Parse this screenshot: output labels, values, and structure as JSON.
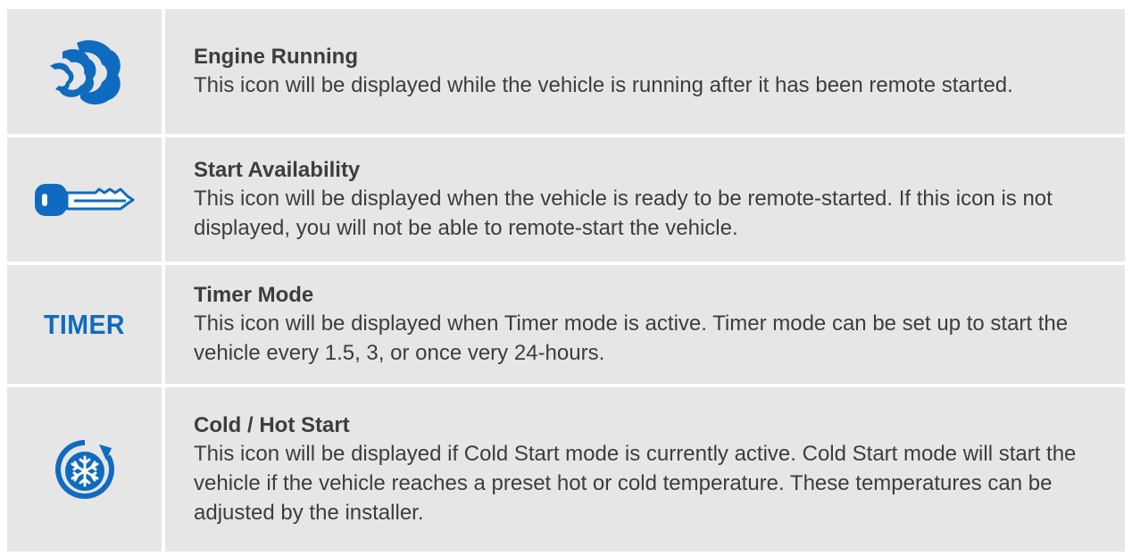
{
  "colors": {
    "row_bg": "#e6e6e6",
    "icon_blue": "#0f6bbf",
    "text": "#3d3d3d"
  },
  "rows": [
    {
      "icon": "engine-running-icon",
      "title": "Engine Running",
      "description": "This icon will be displayed while the vehicle is running after it has been remote started."
    },
    {
      "icon": "key-icon",
      "title": "Start Availability",
      "description": "This icon will be displayed when the vehicle is ready to be remote-started. If this icon is not displayed, you will not be able to remote-start the vehicle."
    },
    {
      "icon": "timer-text-icon",
      "icon_text": "TIMER",
      "title": "Timer Mode",
      "description": "This icon will be displayed when Timer mode is active. Timer mode can be set up to start the vehicle every 1.5, 3, or once very 24-hours."
    },
    {
      "icon": "snowflake-cycle-icon",
      "title": "Cold / Hot Start",
      "description": "This icon will be displayed if Cold Start mode is currently active. Cold Start mode will start the vehicle if the vehicle reaches a preset hot or cold temperature. These temperatures can be adjusted by the installer."
    }
  ]
}
